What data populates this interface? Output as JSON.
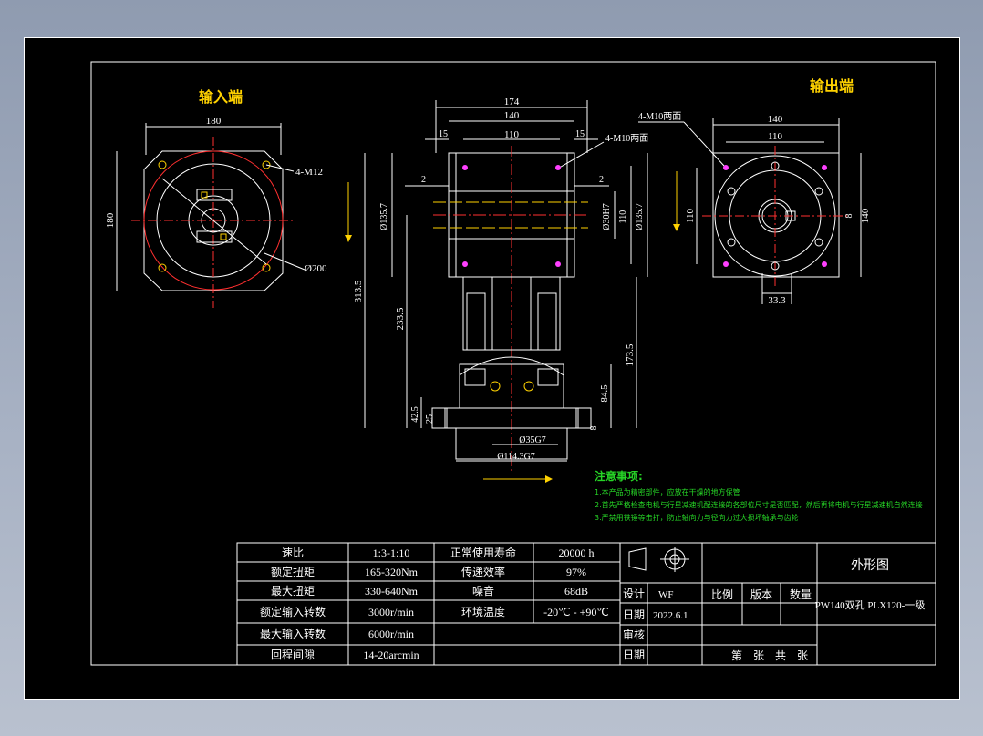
{
  "views": {
    "input_title": "输入端",
    "output_title": "输出端"
  },
  "dims": {
    "input": {
      "width": "180",
      "height": "180",
      "bolts": "4-M12",
      "circle": "Ø200"
    },
    "front": {
      "d174": "174",
      "d140": "140",
      "d110": "110",
      "d15a": "15",
      "d15b": "15",
      "d2a": "2",
      "d2b": "2",
      "holes": "4-M10两面",
      "d1357a": "Ø135.7",
      "d1357b": "Ø135.7",
      "d30h7": "Ø30H7",
      "d110v": "110",
      "d3135": "313.5",
      "d2335": "233.5",
      "d1735": "173.5",
      "d845": "84.5",
      "d425": "42.5",
      "d25": "25",
      "d8": "8",
      "d35g7": "Ø35G7",
      "d114": "Ø114.3G7"
    },
    "output": {
      "holes": "4-M10两面",
      "d140": "140",
      "d110": "110",
      "d110v": "110",
      "d140v": "140",
      "d8": "8",
      "d333": "33.3"
    }
  },
  "notes": {
    "title": "注意事项:",
    "items": [
      "1.本产品为精密部件，应放在干燥的地方保管",
      "2.首先严格检查电机与行星减速机配连接的各部位尺寸是否匹配，然后再将电机与行星减速机自然连接",
      "3.严禁用铁锤等击打，防止轴向力与径向力过大损坏轴承与齿轮"
    ]
  },
  "spec_table": {
    "rows": [
      [
        "速比",
        "1:3-1:10",
        "正常使用寿命",
        "20000 h"
      ],
      [
        "额定扭矩",
        "165-320Nm",
        "传递效率",
        "97%"
      ],
      [
        "最大扭矩",
        "330-640Nm",
        "噪音",
        "68dB"
      ],
      [
        "额定输入转数",
        "3000r/min",
        "环境温度",
        "-20℃ - +90℃"
      ],
      [
        "最大输入转数",
        "6000r/min",
        "",
        ""
      ],
      [
        "回程间隙",
        "14-20arcmin",
        "",
        ""
      ]
    ]
  },
  "title_block": {
    "drawing_name": "外形图",
    "part_name": "PW140双孔 PLX120-一级",
    "design_label": "设计",
    "design_value": "WF",
    "date_label": "日期",
    "date_value": "2022.6.1",
    "scale_label": "比例",
    "version_label": "版本",
    "qty_label": "数量",
    "review_label": "审核",
    "date2_label": "日期",
    "sheet_text": "第    张    共    张"
  }
}
